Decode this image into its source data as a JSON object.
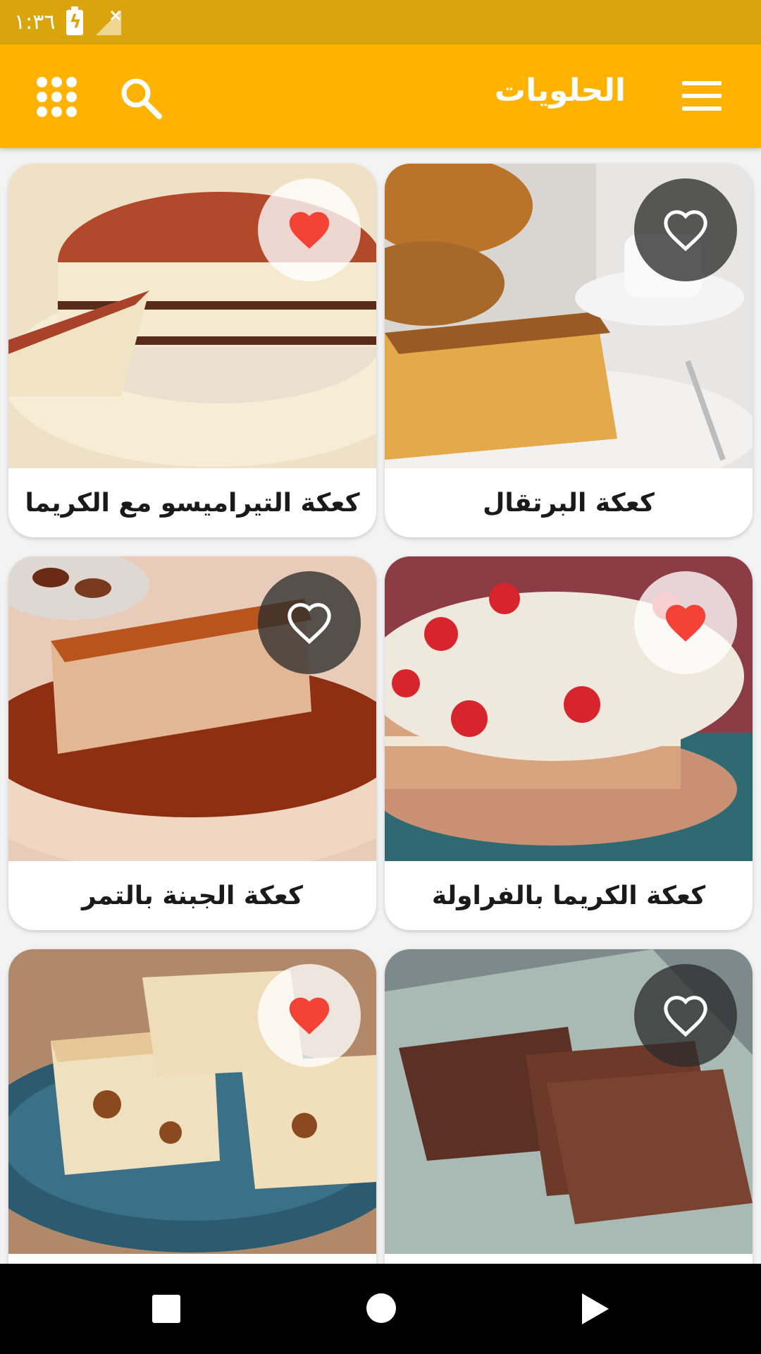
{
  "status_bar": {
    "time": "١:٣٦"
  },
  "app_bar": {
    "title": "الحلويات"
  },
  "colors": {
    "status_bar": "#d9a40c",
    "app_bar": "#ffb300",
    "heart_on": "#f44336",
    "heart_off": "#ffffff"
  },
  "icons": {
    "menu": "menu-icon",
    "search": "search-icon",
    "apps": "apps-grid-icon",
    "favorite": "heart-icon",
    "back": "back-triangle-icon",
    "home": "home-circle-icon",
    "recents": "recents-square-icon"
  },
  "recipes": [
    {
      "title": "كعكة البرتقال",
      "favorite": false
    },
    {
      "title": "كعكة التيراميسو مع الكريما",
      "favorite": true
    },
    {
      "title": "كعكة الكريما بالفراولة",
      "favorite": true
    },
    {
      "title": "كعكة الجبنة بالتمر",
      "favorite": false
    },
    {
      "title": "",
      "favorite": false
    },
    {
      "title": "",
      "favorite": true
    }
  ]
}
